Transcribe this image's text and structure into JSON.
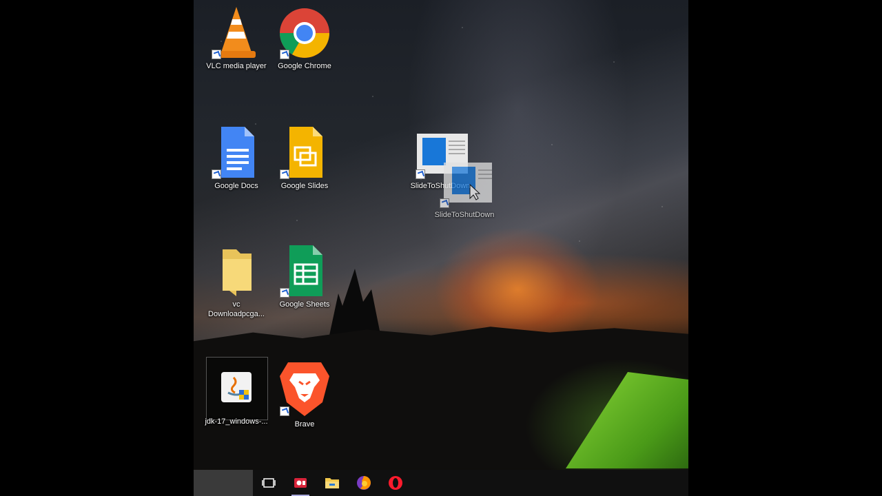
{
  "desktop": {
    "icons": [
      {
        "id": "vlc",
        "label": "VLC media player"
      },
      {
        "id": "chrome",
        "label": "Google Chrome"
      },
      {
        "id": "docs",
        "label": "Google Docs"
      },
      {
        "id": "slides",
        "label": "Google Slides"
      },
      {
        "id": "slide_shut_1",
        "label": "SlideToShutDown"
      },
      {
        "id": "slide_shut_2",
        "label": "SlideToShutDown"
      },
      {
        "id": "vc_folder",
        "label": "vc\nDownloadpcga..."
      },
      {
        "id": "sheets",
        "label": "Google Sheets"
      },
      {
        "id": "jdk",
        "label": "jdk-17_windows-..."
      },
      {
        "id": "brave",
        "label": "Brave"
      }
    ]
  },
  "taskbar": {
    "items": [
      {
        "id": "start",
        "icon": "start-area"
      },
      {
        "id": "task_view",
        "icon": "task-view-icon"
      },
      {
        "id": "recorder",
        "icon": "screen-recorder-icon"
      },
      {
        "id": "explorer",
        "icon": "folder-icon"
      },
      {
        "id": "firefox",
        "icon": "firefox-icon"
      },
      {
        "id": "opera",
        "icon": "opera-icon"
      }
    ]
  },
  "colors": {
    "taskbar_bg": "#101010",
    "label_text": "#ffffff",
    "chrome_red": "#db4437",
    "chrome_yellow": "#f4b400",
    "chrome_green": "#0f9d58",
    "chrome_blue": "#4285f4",
    "docs_blue": "#4285f4",
    "slides_yellow": "#f4b400",
    "sheets_green": "#0f9d58",
    "brave_orange": "#fb542b"
  }
}
